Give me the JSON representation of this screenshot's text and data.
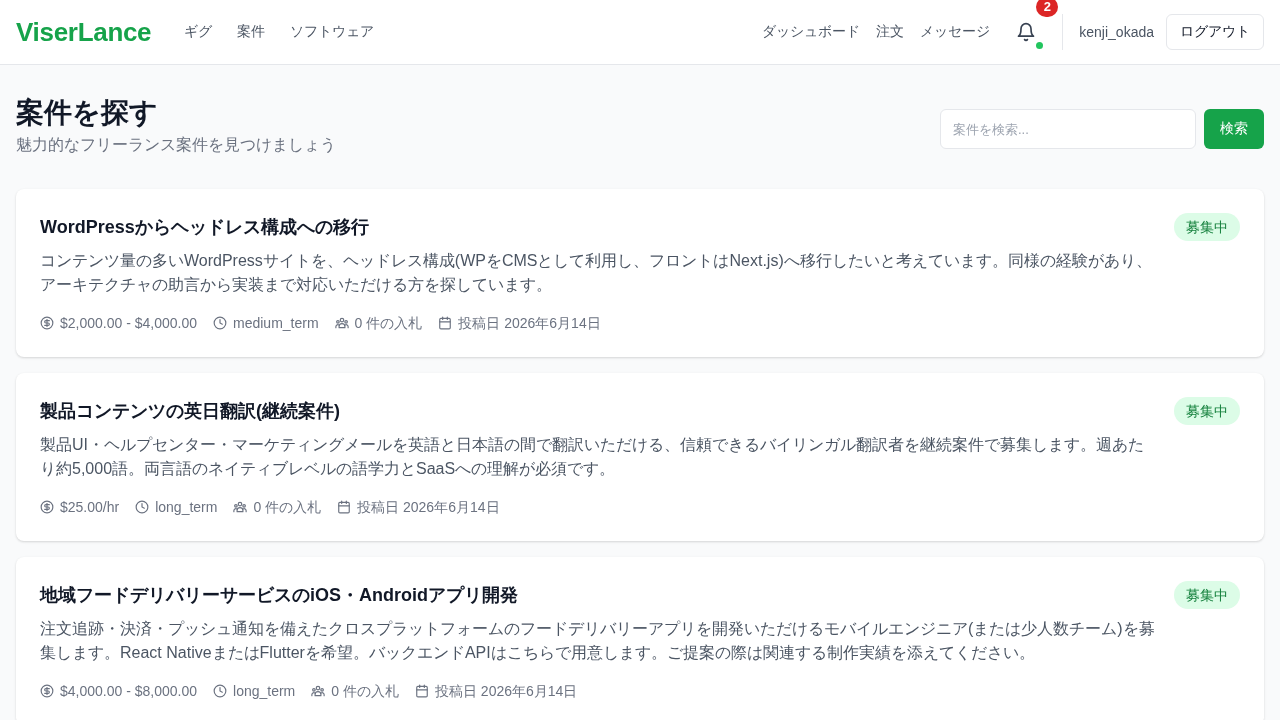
{
  "header": {
    "logo": "ViserLance",
    "nav": [
      "ギグ",
      "案件",
      "ソフトウェア"
    ],
    "user_nav": [
      "ダッシュボード",
      "注文",
      "メッセージ"
    ],
    "notifications": {
      "count": "2",
      "online": true
    },
    "username": "kenji_okada",
    "logout": "ログアウト"
  },
  "page": {
    "title": "案件を探す",
    "subtitle": "魅力的なフリーランス案件を見つけましょう"
  },
  "search": {
    "placeholder": "案件を検索...",
    "button": "検索"
  },
  "jobs": [
    {
      "title": "WordPressからヘッドレス構成への移行",
      "status": "募集中",
      "description": "コンテンツ量の多いWordPressサイトを、ヘッドレス構成(WPをCMSとして利用し、フロントはNext.js)へ移行したいと考えています。同様の経験があり、アーキテクチャの助言から実装まで対応いただける方を探しています。",
      "budget": "$2,000.00 - $4,000.00",
      "duration": "medium_term",
      "bids": "0 件の入札",
      "posted": "投稿日 2026年6月14日"
    },
    {
      "title": "製品コンテンツの英日翻訳(継続案件)",
      "status": "募集中",
      "description": "製品UI・ヘルプセンター・マーケティングメールを英語と日本語の間で翻訳いただける、信頼できるバイリンガル翻訳者を継続案件で募集します。週あたり約5,000語。両言語のネイティブレベルの語学力とSaaSへの理解が必須です。",
      "budget": "$25.00/hr",
      "duration": "long_term",
      "bids": "0 件の入札",
      "posted": "投稿日 2026年6月14日"
    },
    {
      "title": "地域フードデリバリーサービスのiOS・Androidアプリ開発",
      "status": "募集中",
      "description": "注文追跡・決済・プッシュ通知を備えたクロスプラットフォームのフードデリバリーアプリを開発いただけるモバイルエンジニア(または少人数チーム)を募集します。React NativeまたはFlutterを希望。バックエンドAPIはこちらで用意します。ご提案の際は関連する制作実績を添えてください。",
      "budget": "$4,000.00 - $8,000.00",
      "duration": "long_term",
      "bids": "0 件の入札",
      "posted": "投稿日 2026年6月14日"
    }
  ]
}
